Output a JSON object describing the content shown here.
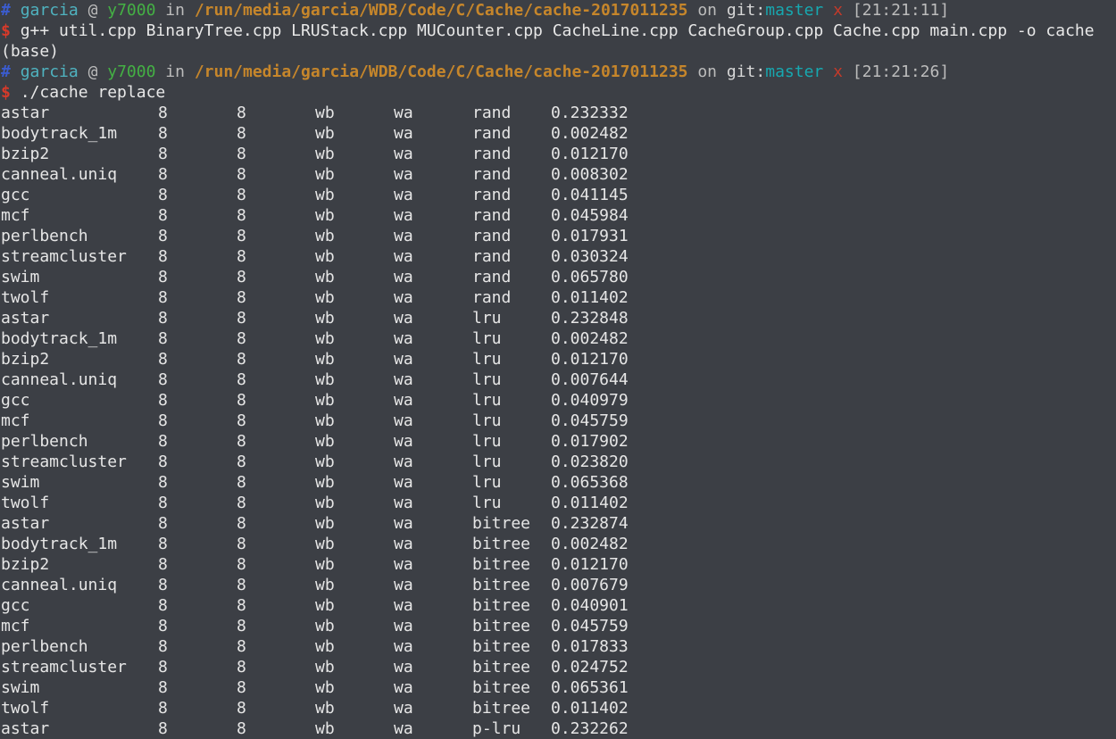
{
  "window": {
    "colors": {
      "background": "#3c3f45",
      "text": "#e6e6e6",
      "hash": "#3b5ccf",
      "user": "#4fb3c0",
      "host": "#44b044",
      "path": "#c6862b",
      "branch": "#17a8b0",
      "dirty": "#c43a2a",
      "dollar": "#d83a2a"
    }
  },
  "prompt1": {
    "hash": "#",
    "user": "garcia",
    "at": "@",
    "host": "y7000",
    "in": "in",
    "path": "/run/media/garcia/WDB/Code/C/Cache/cache-2017011235",
    "on": "on",
    "git": "git:",
    "branch": "master",
    "dirty": "x",
    "time": "[21:21:11]"
  },
  "command1": {
    "dollar": "$",
    "text": "g++ util.cpp BinaryTree.cpp LRUStack.cpp MUCounter.cpp CacheLine.cpp CacheGroup.cpp Cache.cpp main.cpp -o cache"
  },
  "env_line": "(base)",
  "prompt2": {
    "hash": "#",
    "user": "garcia",
    "at": "@",
    "host": "y7000",
    "in": "in",
    "path": "/run/media/garcia/WDB/Code/C/Cache/cache-2017011235",
    "on": "on",
    "git": "git:",
    "branch": "master",
    "dirty": "x",
    "time": "[21:21:26]"
  },
  "command2": {
    "dollar": "$",
    "text": "./cache replace"
  },
  "rows": [
    [
      "astar",
      "8",
      "8",
      "wb",
      "wa",
      "rand",
      "0.232332"
    ],
    [
      "bodytrack_1m",
      "8",
      "8",
      "wb",
      "wa",
      "rand",
      "0.002482"
    ],
    [
      "bzip2",
      "8",
      "8",
      "wb",
      "wa",
      "rand",
      "0.012170"
    ],
    [
      "canneal.uniq",
      "8",
      "8",
      "wb",
      "wa",
      "rand",
      "0.008302"
    ],
    [
      "gcc",
      "8",
      "8",
      "wb",
      "wa",
      "rand",
      "0.041145"
    ],
    [
      "mcf",
      "8",
      "8",
      "wb",
      "wa",
      "rand",
      "0.045984"
    ],
    [
      "perlbench",
      "8",
      "8",
      "wb",
      "wa",
      "rand",
      "0.017931"
    ],
    [
      "streamcluster",
      "8",
      "8",
      "wb",
      "wa",
      "rand",
      "0.030324"
    ],
    [
      "swim",
      "8",
      "8",
      "wb",
      "wa",
      "rand",
      "0.065780"
    ],
    [
      "twolf",
      "8",
      "8",
      "wb",
      "wa",
      "rand",
      "0.011402"
    ],
    [
      "astar",
      "8",
      "8",
      "wb",
      "wa",
      "lru",
      "0.232848"
    ],
    [
      "bodytrack_1m",
      "8",
      "8",
      "wb",
      "wa",
      "lru",
      "0.002482"
    ],
    [
      "bzip2",
      "8",
      "8",
      "wb",
      "wa",
      "lru",
      "0.012170"
    ],
    [
      "canneal.uniq",
      "8",
      "8",
      "wb",
      "wa",
      "lru",
      "0.007644"
    ],
    [
      "gcc",
      "8",
      "8",
      "wb",
      "wa",
      "lru",
      "0.040979"
    ],
    [
      "mcf",
      "8",
      "8",
      "wb",
      "wa",
      "lru",
      "0.045759"
    ],
    [
      "perlbench",
      "8",
      "8",
      "wb",
      "wa",
      "lru",
      "0.017902"
    ],
    [
      "streamcluster",
      "8",
      "8",
      "wb",
      "wa",
      "lru",
      "0.023820"
    ],
    [
      "swim",
      "8",
      "8",
      "wb",
      "wa",
      "lru",
      "0.065368"
    ],
    [
      "twolf",
      "8",
      "8",
      "wb",
      "wa",
      "lru",
      "0.011402"
    ],
    [
      "astar",
      "8",
      "8",
      "wb",
      "wa",
      "bitree",
      "0.232874"
    ],
    [
      "bodytrack_1m",
      "8",
      "8",
      "wb",
      "wa",
      "bitree",
      "0.002482"
    ],
    [
      "bzip2",
      "8",
      "8",
      "wb",
      "wa",
      "bitree",
      "0.012170"
    ],
    [
      "canneal.uniq",
      "8",
      "8",
      "wb",
      "wa",
      "bitree",
      "0.007679"
    ],
    [
      "gcc",
      "8",
      "8",
      "wb",
      "wa",
      "bitree",
      "0.040901"
    ],
    [
      "mcf",
      "8",
      "8",
      "wb",
      "wa",
      "bitree",
      "0.045759"
    ],
    [
      "perlbench",
      "8",
      "8",
      "wb",
      "wa",
      "bitree",
      "0.017833"
    ],
    [
      "streamcluster",
      "8",
      "8",
      "wb",
      "wa",
      "bitree",
      "0.024752"
    ],
    [
      "swim",
      "8",
      "8",
      "wb",
      "wa",
      "bitree",
      "0.065361"
    ],
    [
      "twolf",
      "8",
      "8",
      "wb",
      "wa",
      "bitree",
      "0.011402"
    ],
    [
      "astar",
      "8",
      "8",
      "wb",
      "wa",
      "p-lru",
      "0.232262"
    ]
  ]
}
